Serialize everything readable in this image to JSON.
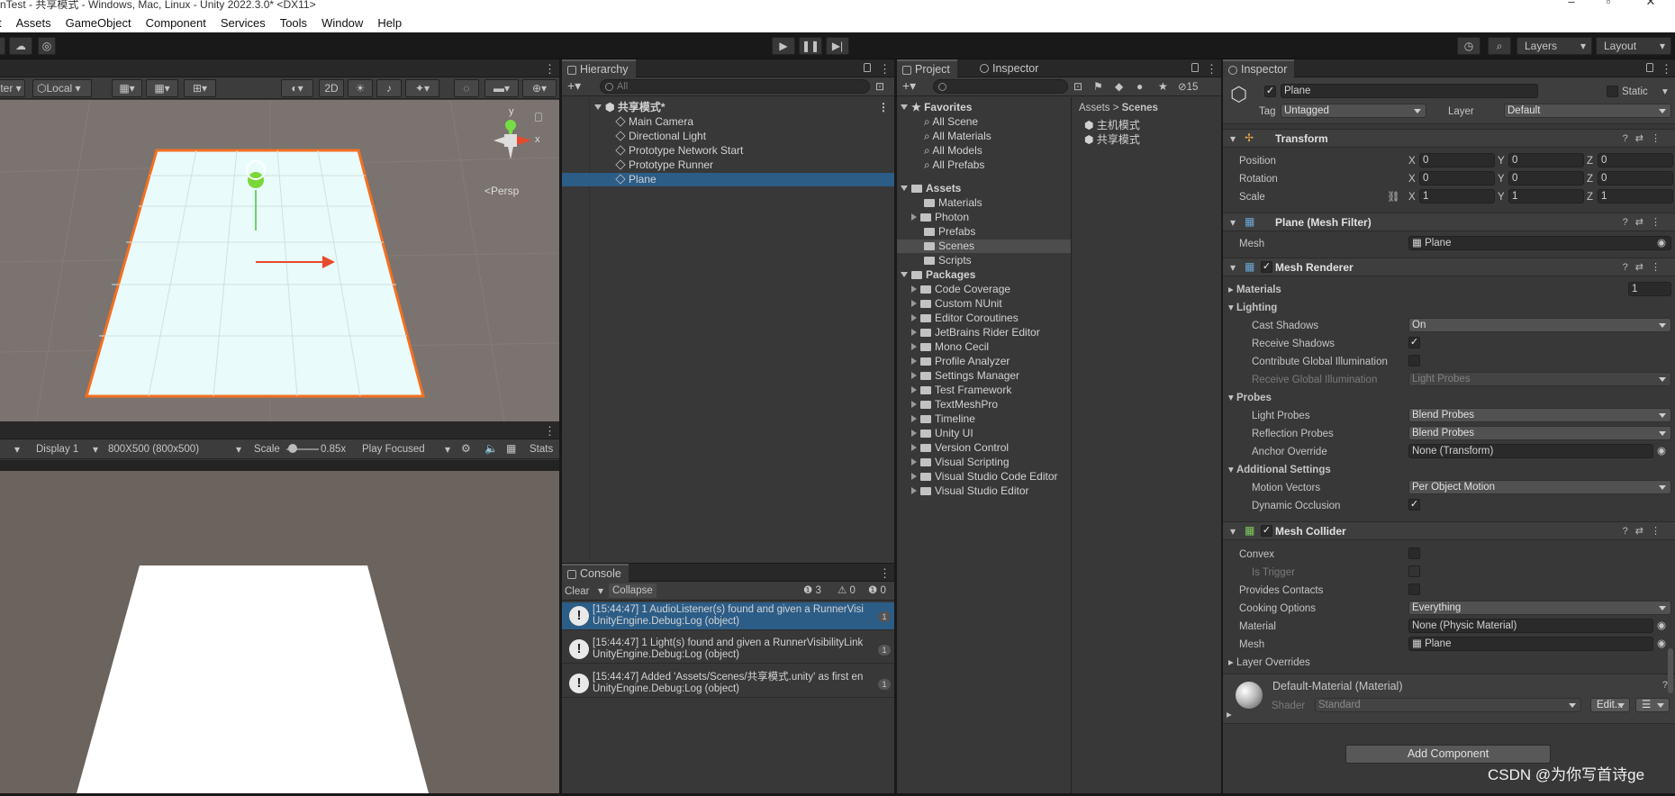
{
  "window": {
    "title": "nTest - 共享模式 - Windows, Mac, Linux - Unity 2022.3.0* <DX11>"
  },
  "menu": [
    "t",
    "Assets",
    "GameObject",
    "Component",
    "Services",
    "Tools",
    "Window",
    "Help"
  ],
  "toolbar": {
    "layers_label": "Layers",
    "layout_label": "Layout"
  },
  "scene_view": {
    "tool_local": "Local",
    "btn_2d": "2D",
    "persp_label": "<Persp",
    "gizmo_y": "y",
    "gizmo_x": "x"
  },
  "game_view": {
    "display": "Display 1",
    "resolution": "800X500 (800x500)",
    "scale_label": "Scale",
    "scale_value": "0.85x",
    "play_mode": "Play Focused",
    "stats": "Stats"
  },
  "hierarchy": {
    "tab": "Hierarchy",
    "search_placeholder": "All",
    "scene_name": "共享模式*",
    "items": [
      "Main Camera",
      "Directional Light",
      "Prototype Network Start",
      "Prototype Runner",
      "Plane"
    ],
    "selected": "Plane"
  },
  "console": {
    "tab": "Console",
    "clear": "Clear",
    "collapse": "Collapse",
    "count_info": "3",
    "count_warn": "0",
    "count_error": "0",
    "messages": [
      {
        "line1": "[15:44:47] 1 AudioListener(s) found and given a RunnerVisi",
        "line2": "UnityEngine.Debug:Log (object)",
        "count": "1"
      },
      {
        "line1": "[15:44:47] 1 Light(s) found and given a RunnerVisibilityLink",
        "line2": "UnityEngine.Debug:Log (object)",
        "count": "1"
      },
      {
        "line1": "[15:44:47] Added 'Assets/Scenes/共享模式.unity' as first en",
        "line2": "UnityEngine.Debug:Log (object)",
        "count": "1"
      }
    ]
  },
  "project": {
    "tab_project": "Project",
    "tab_inspector": "Inspector",
    "hidden_count": "15",
    "favorites_label": "Favorites",
    "favorites": [
      "All Scene",
      "All Materials",
      "All Models",
      "All Prefabs"
    ],
    "assets_label": "Assets",
    "assets": [
      "Materials",
      "Photon",
      "Prefabs",
      "Scenes",
      "Scripts"
    ],
    "selected_folder": "Scenes",
    "packages_label": "Packages",
    "packages": [
      "Code Coverage",
      "Custom NUnit",
      "Editor Coroutines",
      "JetBrains Rider Editor",
      "Mono Cecil",
      "Profile Analyzer",
      "Settings Manager",
      "Test Framework",
      "TextMeshPro",
      "Timeline",
      "Unity UI",
      "Version Control",
      "Visual Scripting",
      "Visual Studio Code Editor",
      "Visual Studio Editor"
    ],
    "breadcrumb_root": "Assets",
    "breadcrumb_sep": ">",
    "breadcrumb_current": "Scenes",
    "files": [
      "主机模式",
      "共享模式"
    ]
  },
  "inspector": {
    "tab": "Inspector",
    "object_name": "Plane",
    "static_label": "Static",
    "tag_label": "Tag",
    "tag_value": "Untagged",
    "layer_label": "Layer",
    "layer_value": "Default",
    "transform": {
      "title": "Transform",
      "position_label": "Position",
      "rotation_label": "Rotation",
      "scale_label": "Scale",
      "position": [
        "0",
        "0",
        "0"
      ],
      "rotation": [
        "0",
        "0",
        "0"
      ],
      "scale": [
        "1",
        "1",
        "1"
      ],
      "x": "X",
      "y": "Y",
      "z": "Z"
    },
    "mesh_filter": {
      "title": "Plane (Mesh Filter)",
      "mesh_label": "Mesh",
      "mesh_value": "Plane"
    },
    "mesh_renderer": {
      "title": "Mesh Renderer",
      "materials_label": "Materials",
      "materials_count": "1",
      "lighting_label": "Lighting",
      "cast_shadows_label": "Cast Shadows",
      "cast_shadows_value": "On",
      "receive_shadows_label": "Receive Shadows",
      "contribute_gi_label": "Contribute Global Illumination",
      "receive_gi_label": "Receive Global Illumination",
      "receive_gi_value": "Light Probes",
      "probes_label": "Probes",
      "light_probes_label": "Light Probes",
      "light_probes_value": "Blend Probes",
      "reflection_probes_label": "Reflection Probes",
      "reflection_probes_value": "Blend Probes",
      "anchor_override_label": "Anchor Override",
      "anchor_override_value": "None (Transform)",
      "additional_label": "Additional Settings",
      "motion_vectors_label": "Motion Vectors",
      "motion_vectors_value": "Per Object Motion",
      "dynamic_occlusion_label": "Dynamic Occlusion"
    },
    "mesh_collider": {
      "title": "Mesh Collider",
      "convex_label": "Convex",
      "is_trigger_label": "Is Trigger",
      "provides_contacts_label": "Provides Contacts",
      "cooking_label": "Cooking Options",
      "cooking_value": "Everything",
      "material_label": "Material",
      "material_value": "None (Physic Material)",
      "mesh_label": "Mesh",
      "mesh_value": "Plane",
      "layer_overrides_label": "Layer Overrides"
    },
    "material": {
      "title": "Default-Material (Material)",
      "shader_label": "Shader",
      "shader_value": "Standard",
      "edit_label": "Edit..."
    },
    "add_component": "Add Component"
  },
  "watermark": "CSDN @为你写首诗ge",
  "colors": {
    "selection": "#2c5d87",
    "plane_outline": "#f37021",
    "plane_fill": "#e9fbfb",
    "game_bg": "#6b635d",
    "scene_bg": "#7a736f"
  }
}
